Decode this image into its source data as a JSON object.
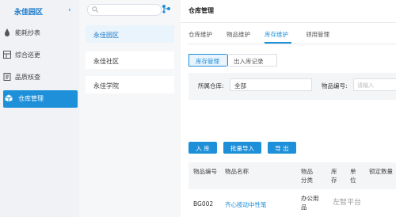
{
  "nav": {
    "org_name": "永佳园区",
    "items": [
      {
        "label": "能耗抄表",
        "icon": "drop-icon"
      },
      {
        "label": "综合巡更",
        "icon": "grid-icon"
      },
      {
        "label": "品质核查",
        "icon": "checklist-icon"
      },
      {
        "label": "仓库管理",
        "icon": "box-icon",
        "active": true
      }
    ]
  },
  "mid": {
    "search_placeholder": "",
    "orgs": [
      "永佳园区",
      "永佳社区",
      "永佳学院"
    ]
  },
  "main": {
    "title": "仓库管理",
    "tabs": [
      "仓库维护",
      "物品维护",
      "库存维护",
      "领用管理"
    ],
    "active_tab": "库存维护",
    "subtabs": [
      "库存管理",
      "出入库记录"
    ],
    "filter": {
      "warehouse_label": "所属仓库:",
      "warehouse_value": "全部",
      "code_label": "物品编号:",
      "code_placeholder": "请输入"
    },
    "buttons": [
      "入 库",
      "批量导入",
      "导 出"
    ],
    "table": {
      "headers": [
        "物品编号",
        "物品名称",
        "物品分类",
        "库存",
        "单位",
        "锁定数量"
      ],
      "rows": [
        [
          "BG002",
          "齐心按动中性笔",
          "办公用品",
          "",
          "",
          ""
        ]
      ]
    }
  },
  "colors": {
    "accent": "#1e8fd9",
    "nav_bg": "#f0f2f6"
  },
  "watermark": "左智平台"
}
